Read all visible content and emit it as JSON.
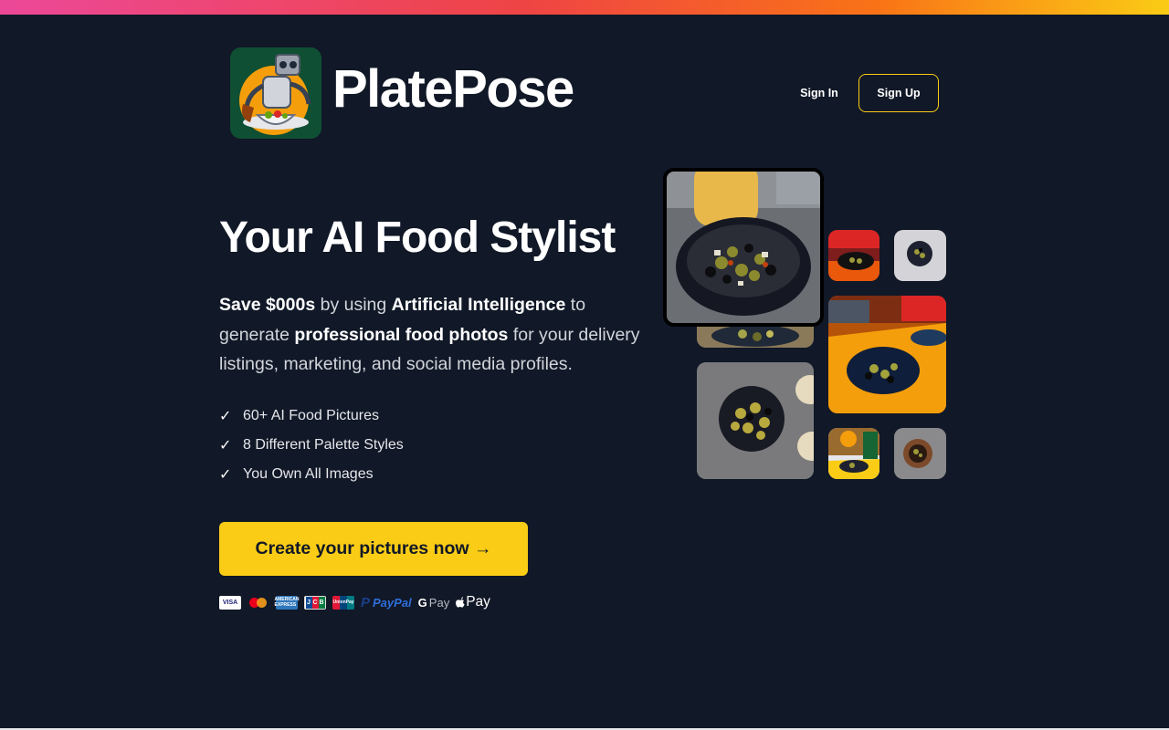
{
  "brand": {
    "name": "PlatePose",
    "logo_icon": "robot-chef-icon"
  },
  "nav": {
    "sign_in": "Sign In",
    "sign_up": "Sign Up"
  },
  "hero": {
    "headline": "Your AI Food Stylist",
    "description": {
      "p1_bold": "Save $000s",
      "p2": " by using ",
      "p3_bold": "Artificial Intelligence",
      "p4": " to generate ",
      "p5_bold": "professional food photos",
      "p6": " for your delivery listings, marketing, and social media profiles."
    },
    "features": [
      "60+ AI Food Pictures",
      "8 Different Palette Styles",
      "You Own All Images"
    ],
    "check_glyph": "✓",
    "cta": "Create your pictures now →"
  },
  "payments": {
    "visa": "VISA",
    "amex": "AMERICAN EXPRESS",
    "jcb": [
      "J",
      "C",
      "B"
    ],
    "unionpay": "UnionPay",
    "paypal_mark": "P",
    "paypal": "PayPal",
    "gpay_mark": "G",
    "gpay": "Pay",
    "applepay": " Pay"
  },
  "gallery": {
    "featured_icon": "olives-bowl-photo",
    "photo_icon": "food-photo"
  },
  "colors": {
    "background": "#111827",
    "accent": "#facc15",
    "gradient": [
      "#ec4899",
      "#ef4444",
      "#f97316",
      "#facc15"
    ]
  }
}
